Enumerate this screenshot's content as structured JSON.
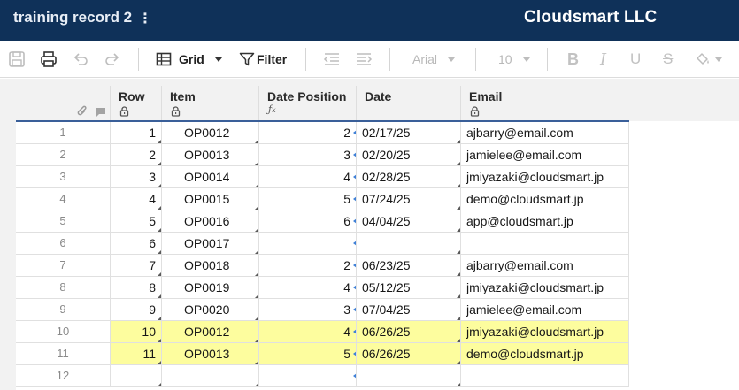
{
  "app": {
    "sheet_title": "training record 2",
    "menu_icon": "kebab-icon",
    "company": "Cloudsmart LLC"
  },
  "toolbar": {
    "view_label": "Grid",
    "filter_label": "Filter",
    "font_name": "Arial",
    "font_size": "10",
    "icons": [
      "save-icon",
      "print-icon",
      "undo-icon",
      "redo-icon",
      "grid-icon",
      "filter-icon",
      "outdent-icon",
      "indent-icon",
      "bold-icon",
      "italic-icon",
      "underline-icon",
      "strikethrough-icon",
      "fill-color-icon"
    ]
  },
  "columns": [
    {
      "key": "row",
      "label": "Row",
      "icon": "lock-icon"
    },
    {
      "key": "item",
      "label": "Item",
      "icon": "lock-icon"
    },
    {
      "key": "date_position",
      "label": "Date Position",
      "icon": "formula-icon"
    },
    {
      "key": "date",
      "label": "Date",
      "icon": ""
    },
    {
      "key": "email",
      "label": "Email",
      "icon": "lock-icon"
    }
  ],
  "rows": [
    {
      "num": "1",
      "row": "1",
      "item": "OP0012",
      "date_position": "2",
      "date": "02/17/25",
      "email": "ajbarry@email.com",
      "highlight": false
    },
    {
      "num": "2",
      "row": "2",
      "item": "OP0013",
      "date_position": "3",
      "date": "02/20/25",
      "email": "jamielee@email.com",
      "highlight": false
    },
    {
      "num": "3",
      "row": "3",
      "item": "OP0014",
      "date_position": "4",
      "date": "02/28/25",
      "email": "jmiyazaki@cloudsmart.jp",
      "highlight": false
    },
    {
      "num": "4",
      "row": "4",
      "item": "OP0015",
      "date_position": "5",
      "date": "07/24/25",
      "email": "demo@cloudsmart.jp",
      "highlight": false
    },
    {
      "num": "5",
      "row": "5",
      "item": "OP0016",
      "date_position": "6",
      "date": "04/04/25",
      "email": "app@cloudsmart.jp",
      "highlight": false
    },
    {
      "num": "6",
      "row": "6",
      "item": "OP0017",
      "date_position": "",
      "date": "",
      "email": "",
      "highlight": false
    },
    {
      "num": "7",
      "row": "7",
      "item": "OP0018",
      "date_position": "2",
      "date": "06/23/25",
      "email": "ajbarry@email.com",
      "highlight": false
    },
    {
      "num": "8",
      "row": "8",
      "item": "OP0019",
      "date_position": "4",
      "date": "05/12/25",
      "email": "jmiyazaki@cloudsmart.jp",
      "highlight": false
    },
    {
      "num": "9",
      "row": "9",
      "item": "OP0020",
      "date_position": "3",
      "date": "07/04/25",
      "email": "jamielee@email.com",
      "highlight": false
    },
    {
      "num": "10",
      "row": "10",
      "item": "OP0012",
      "date_position": "4",
      "date": "06/26/25",
      "email": "jmiyazaki@cloudsmart.jp",
      "highlight": true
    },
    {
      "num": "11",
      "row": "11",
      "item": "OP0013",
      "date_position": "5",
      "date": "06/26/25",
      "email": "demo@cloudsmart.jp",
      "highlight": true
    },
    {
      "num": "12",
      "row": "",
      "item": "",
      "date_position": "",
      "date": "",
      "email": "",
      "highlight": false
    }
  ],
  "colors": {
    "titlebar": "#0f3159",
    "highlight": "#fdfd9e",
    "header_rule": "#3a5f99",
    "formula_marker": "#3d7fd6"
  }
}
